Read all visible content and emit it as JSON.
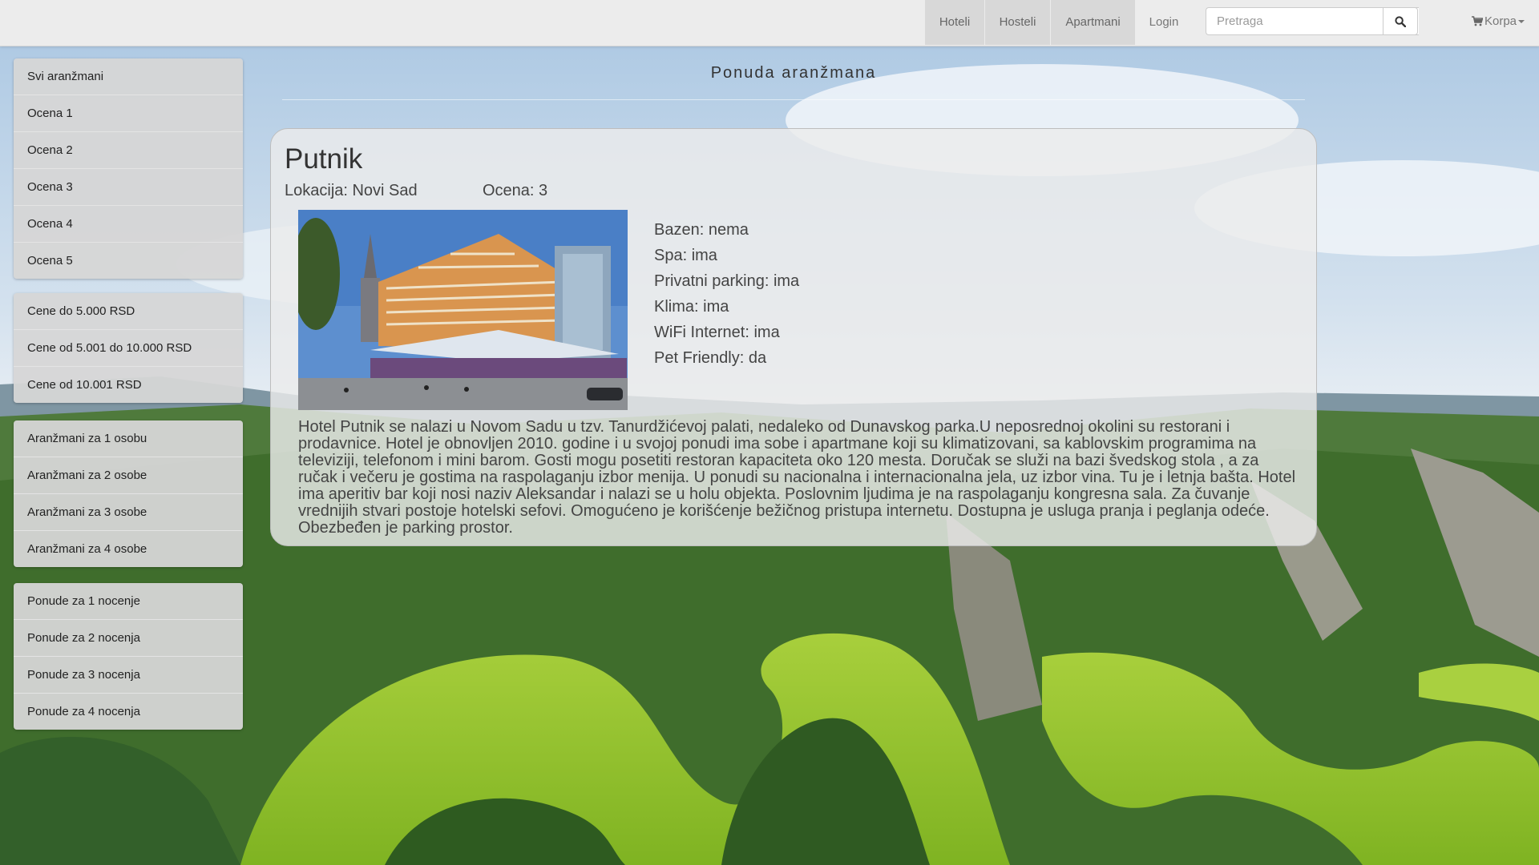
{
  "navbar": {
    "links": [
      {
        "label": "Hoteli",
        "active": true
      },
      {
        "label": "Hosteli",
        "active": true
      },
      {
        "label": "Apartmani",
        "active": true
      },
      {
        "label": "Login",
        "active": false
      }
    ],
    "search_placeholder": "Pretraga",
    "search_value": "",
    "cart_label": "Korpa"
  },
  "sidebar": {
    "groups": [
      {
        "items": [
          "Svi aranžmani",
          "Ocena 1",
          "Ocena 2",
          "Ocena 3",
          "Ocena 4",
          "Ocena 5"
        ]
      },
      {
        "items": [
          "Cene do 5.000 RSD",
          "Cene od 5.001 do 10.000 RSD",
          "Cene od 10.001 RSD"
        ]
      },
      {
        "items": [
          "Aranžmani za 1 osobu",
          "Aranžmani za 2 osobe",
          "Aranžmani za 3 osobe",
          "Aranžmani za 4 osobe"
        ]
      },
      {
        "items": [
          "Ponude za 1 nocenje",
          "Ponude za 2 nocenja",
          "Ponude za 3 nocenja",
          "Ponude za 4 nocenja"
        ]
      }
    ]
  },
  "main": {
    "heading": "Ponuda aranžmana",
    "offer": {
      "name": "Putnik",
      "location": "Lokacija: Novi Sad",
      "rating": "Ocena: 3",
      "features": [
        "Bazen: nema",
        "Spa: ima",
        "Privatni parking: ima",
        "Klima: ima",
        "WiFi Internet: ima",
        "Pet Friendly: da"
      ],
      "description": "Hotel Putnik se nalazi u Novom Sadu u tzv. Tanurdžićevoj palati, nedaleko od Dunavskog parka.U neposrednoj okolini su restorani i prodavnice. Hotel je obnovljen 2010. godine i u svojoj ponudi ima sobe i apartmane koji su klimatizovani, sa kablovskim programima na televiziji, telefonom i mini barom. Gosti mogu posetiti restoran kapaciteta oko 120 mesta. Doručak se služi na bazi švedskog stola , a za ručak i večeru je gostima na raspolaganju izbor menija. U ponudi su nacionalna i internacionalna jela, uz izbor vina. Tu je i letnja bašta. Hotel ima aperitiv bar koji nosi naziv Aleksandar i nalazi se u holu objekta. Poslovnim ljudima je na raspolaganju kongresna sala. Za čuvanje vrednijih stvari postoje hotelski sefovi. Omogućeno je korišćenje bežičnog pristupa internetu. Dostupna je usluga pranja i peglanja odeće. Obezbeđen je parking prostor."
    }
  },
  "icons": {
    "search": "search-icon",
    "cart": "cart-icon",
    "caret": "caret-down-icon"
  }
}
